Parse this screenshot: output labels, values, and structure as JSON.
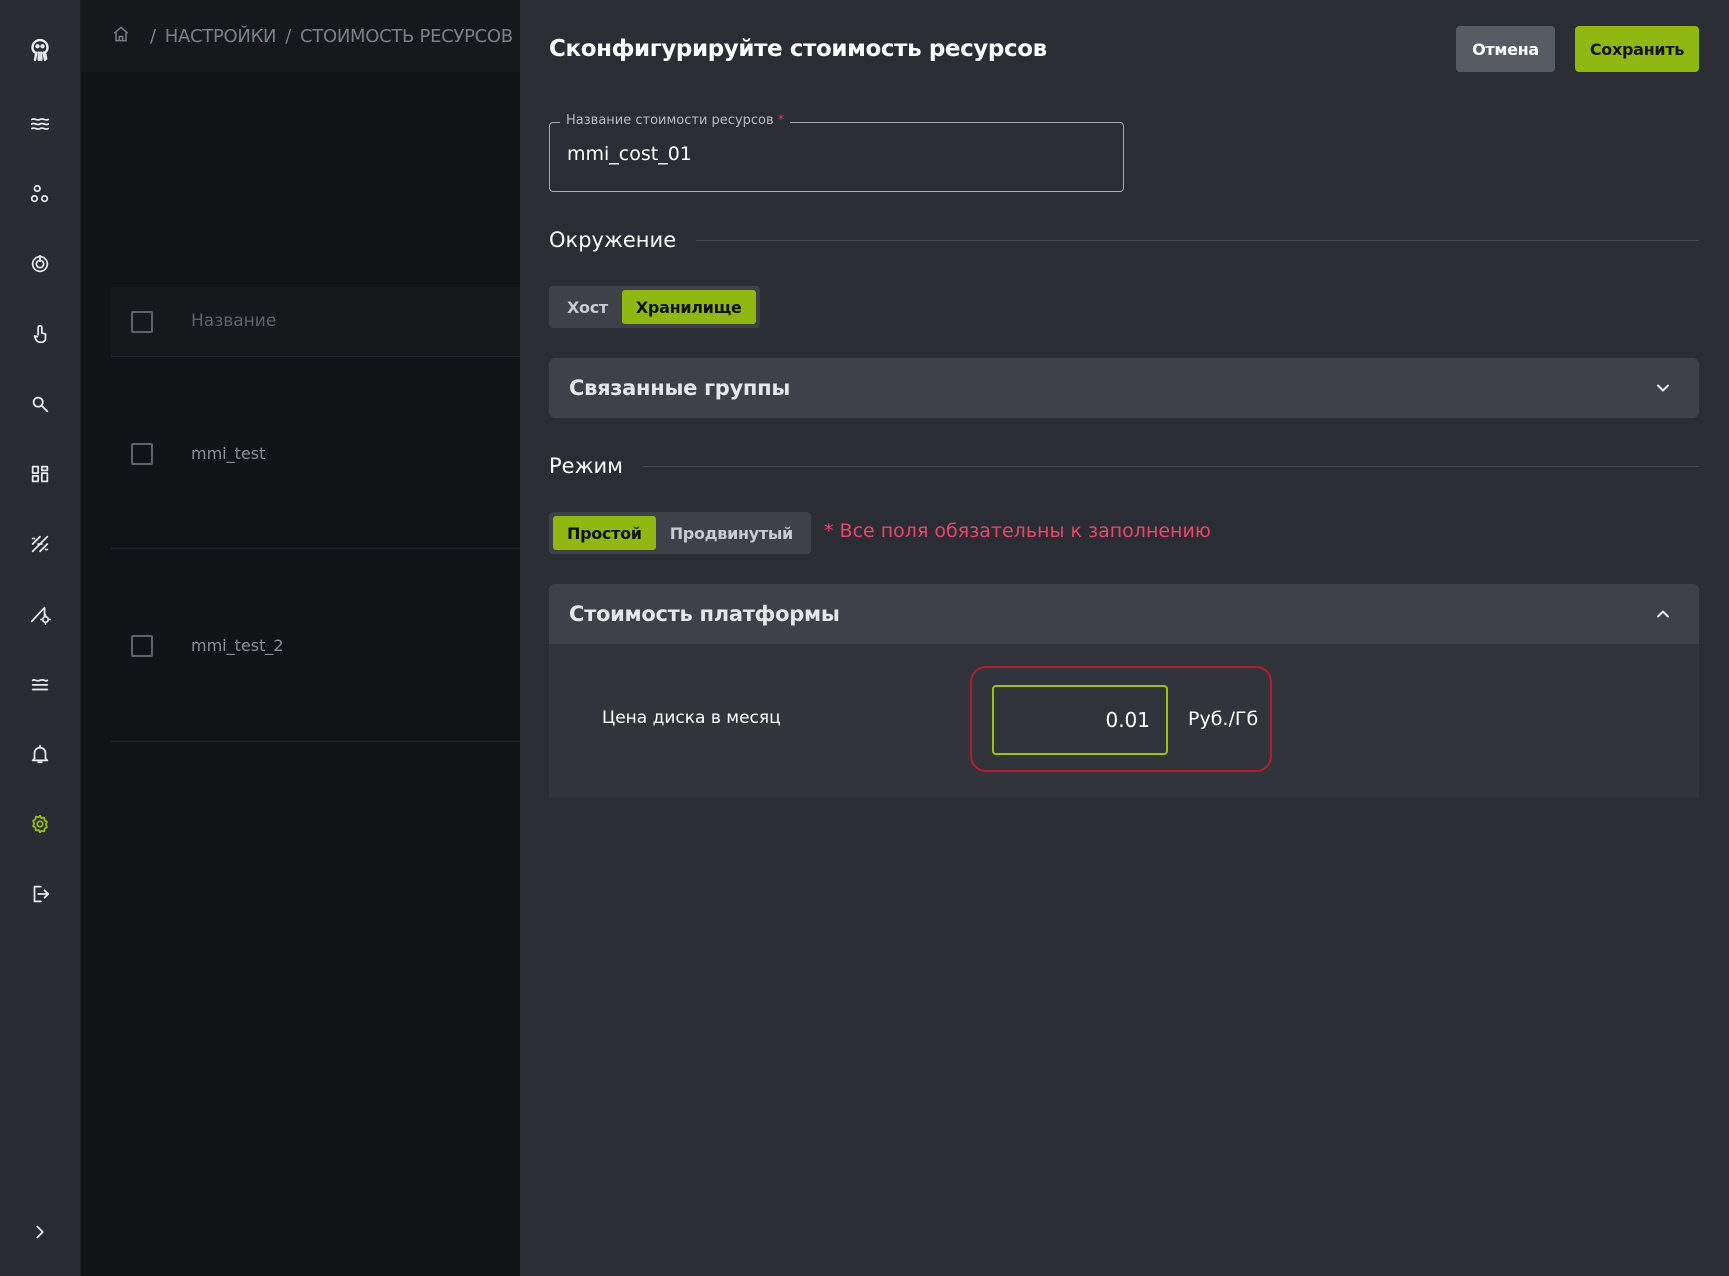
{
  "breadcrumb": {
    "home_icon": "home-icon",
    "part1": "НАСТРОЙКИ",
    "part2": "СТОИМОСТЬ РЕСУРСОВ",
    "separator": "/"
  },
  "nav": [
    "octopus-logo-icon",
    "waves-icon",
    "nodes-icon",
    "target-icon",
    "touch-icon",
    "search-icon",
    "dashboard-icon",
    "pattern-icon",
    "tools-gear-icon",
    "layers-icon",
    "bell-icon",
    "settings-gear-icon",
    "logout-icon",
    "chevron-right-icon"
  ],
  "table": {
    "column_name": "Название",
    "rows": [
      {
        "name": "mmi_test"
      },
      {
        "name": "mmi_test_2"
      }
    ]
  },
  "drawer": {
    "title": "Сконфигурируйте стоимость ресурсов",
    "cancel_label": "Отмена",
    "save_label": "Сохранить",
    "name_field": {
      "label": "Название стоимости ресурсов",
      "required_mark": "*",
      "value": "mmi_cost_01"
    },
    "environment": {
      "label": "Окружение",
      "options": [
        "Хост",
        "Хранилище"
      ],
      "selected": "Хранилище"
    },
    "linked_groups": {
      "label": "Связанные группы",
      "expanded": false
    },
    "mode": {
      "label": "Режим",
      "options": [
        "Простой",
        "Продвинутый"
      ],
      "selected": "Простой",
      "required_note": "* Все поля обязательны к заполнению"
    },
    "platform_cost": {
      "label": "Стоимость платформы",
      "expanded": true,
      "price_label": "Цена диска в месяц",
      "price_value": "0.01",
      "unit": "Руб./Гб"
    }
  },
  "colors": {
    "accent": "#8fb912",
    "drawer_bg": "#2a2d33",
    "error": "#e8476a",
    "highlight": "#b51c2c"
  }
}
